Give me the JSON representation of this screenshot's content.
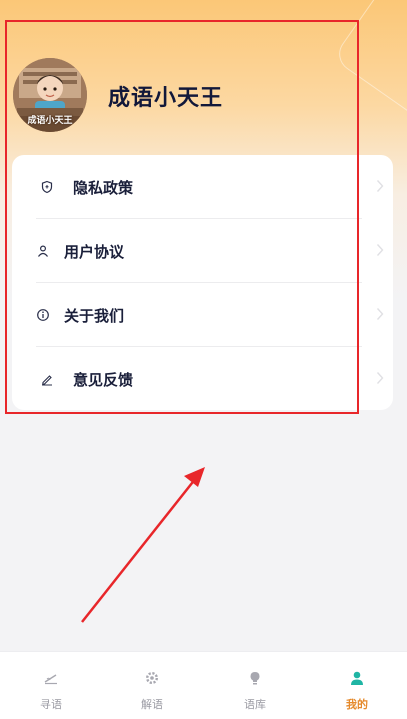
{
  "profile": {
    "name": "成语小天王",
    "avatar_caption": "成语小天王"
  },
  "menu": {
    "items": [
      {
        "label": "隐私政策",
        "icon": "shield-icon"
      },
      {
        "label": "用户协议",
        "icon": "user-icon"
      },
      {
        "label": "关于我们",
        "icon": "info-icon"
      },
      {
        "label": "意见反馈",
        "icon": "pencil-icon"
      }
    ]
  },
  "tabbar": {
    "tabs": [
      {
        "label": "寻语",
        "icon": "writing-icon",
        "active": false
      },
      {
        "label": "解语",
        "icon": "gear-icon",
        "active": false
      },
      {
        "label": "语库",
        "icon": "lightbulb-icon",
        "active": false
      },
      {
        "label": "我的",
        "icon": "person-icon",
        "active": true
      }
    ]
  },
  "colors": {
    "accent": "#e58a2c",
    "active_tab_icon": "#1fb5a4",
    "annotation": "#e8262a",
    "header_gradient_top": "#fbc777",
    "page_background": "#f3f3f5"
  }
}
